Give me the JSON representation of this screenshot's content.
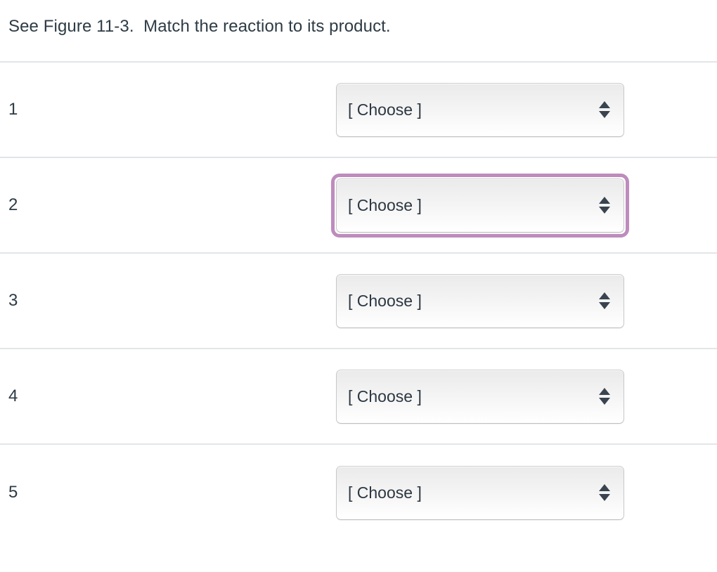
{
  "question": {
    "prompt": "See Figure 11-3.  Match the reaction to its product."
  },
  "theme": {
    "focus_ring_color": "#bd8cbd",
    "divider_color": "#e3e5e7",
    "text_color": "#2d3b45",
    "select_border_color": "#c8c8c8"
  },
  "match_rows": [
    {
      "label": "1",
      "select": {
        "value": "[ Choose ]",
        "focused": false
      }
    },
    {
      "label": "2",
      "select": {
        "value": "[ Choose ]",
        "focused": true
      }
    },
    {
      "label": "3",
      "select": {
        "value": "[ Choose ]",
        "focused": false
      }
    },
    {
      "label": "4",
      "select": {
        "value": "[ Choose ]",
        "focused": false
      }
    },
    {
      "label": "5",
      "select": {
        "value": "[ Choose ]",
        "focused": false
      }
    }
  ],
  "icons": {
    "stepper_up": "triangle-up-icon",
    "stepper_down": "triangle-down-icon"
  }
}
